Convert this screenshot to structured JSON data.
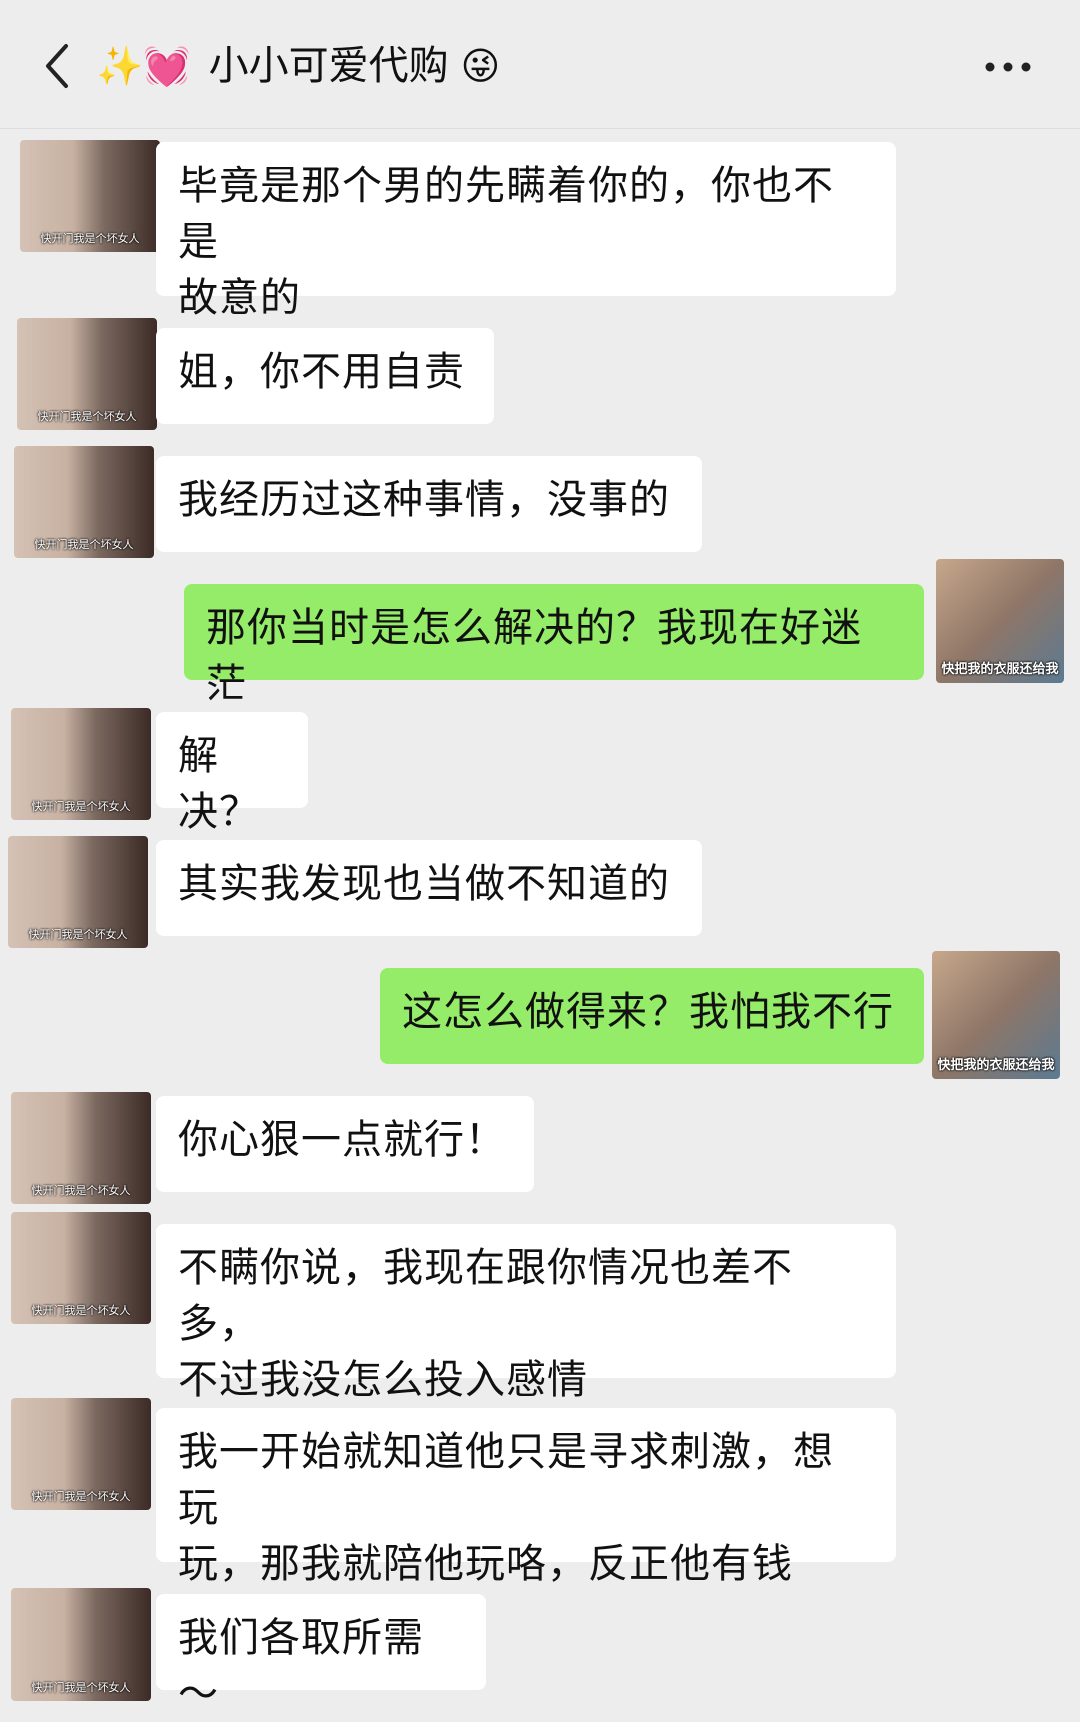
{
  "header": {
    "title_prefix_emoji": "✨💓",
    "title": "小小可爱代购",
    "title_suffix_emoji": "😜",
    "back_icon": "chevron-left-icon",
    "more_icon": "more-dots-icon"
  },
  "colors": {
    "background": "#ededed",
    "incoming_bubble": "#ffffff",
    "outgoing_bubble": "#95ec69"
  },
  "avatars": {
    "contact_caption": "快开门我是个坏女人",
    "self_caption": "快把我的衣服还给我"
  },
  "messages": [
    {
      "side": "in",
      "text": "毕竟是那个男的先瞒着你的，你也不是\n故意的"
    },
    {
      "side": "in",
      "text": "姐，你不用自责"
    },
    {
      "side": "in",
      "text": "我经历过这种事情，没事的"
    },
    {
      "side": "out",
      "text": "那你当时是怎么解决的？我现在好迷茫"
    },
    {
      "side": "in",
      "text": "解决？"
    },
    {
      "side": "in",
      "text": "其实我发现也当做不知道的"
    },
    {
      "side": "out",
      "text": "这怎么做得来？我怕我不行"
    },
    {
      "side": "in",
      "text": "你心狠一点就行！"
    },
    {
      "side": "in",
      "text": "不瞒你说，我现在跟你情况也差不多，\n不过我没怎么投入感情"
    },
    {
      "side": "in",
      "text": "我一开始就知道他只是寻求刺激，想玩\n玩，那我就陪他玩咯，反正他有钱"
    },
    {
      "side": "in",
      "text": "我们各取所需～"
    }
  ]
}
